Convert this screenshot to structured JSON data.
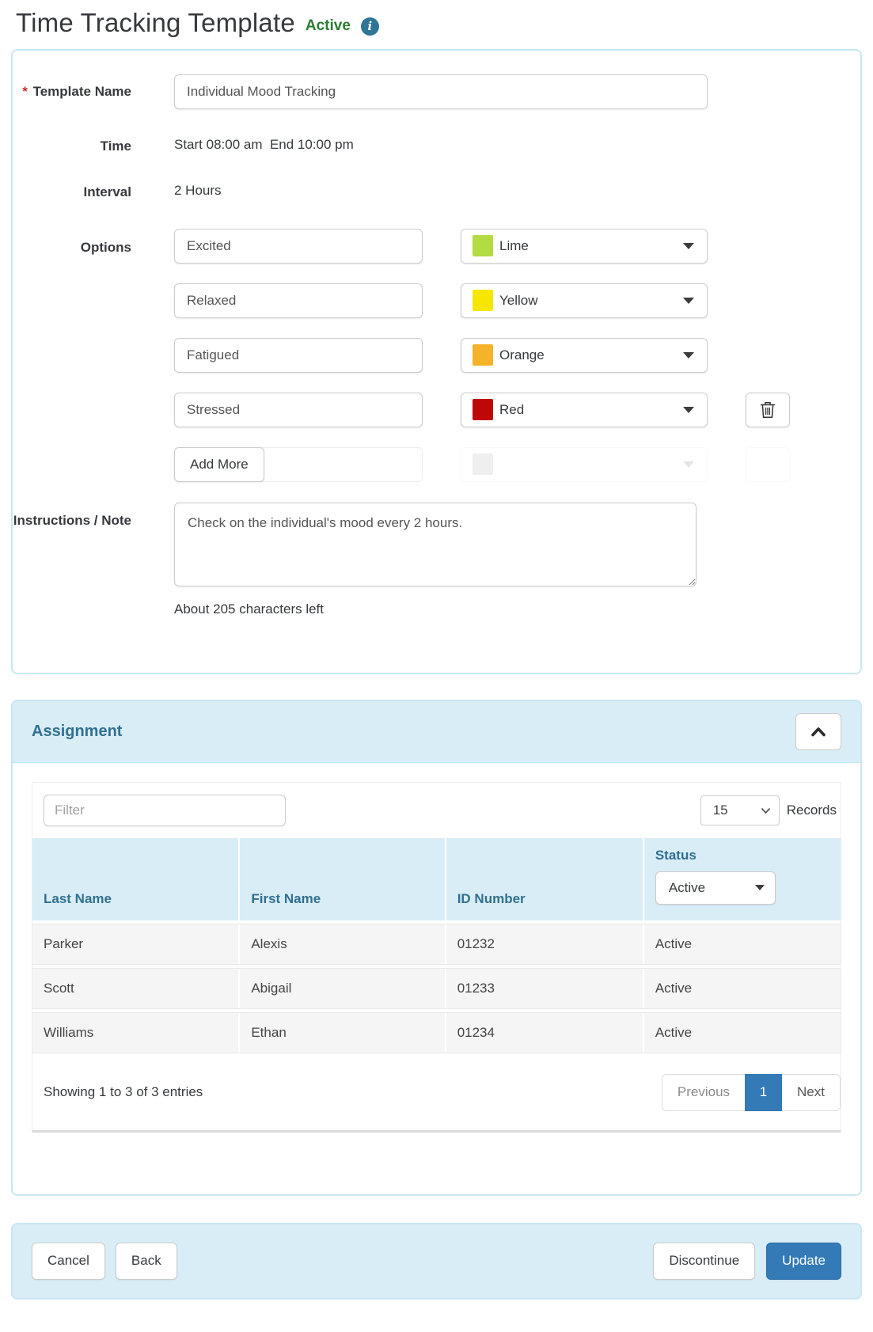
{
  "page": {
    "title": "Time Tracking Template",
    "status_badge": "Active"
  },
  "icons": {
    "info": "info-circle",
    "collapse": "chevron-up",
    "delete": "trash",
    "color_dropdown": "caret-down",
    "records_select": "chevron-down"
  },
  "colors": {
    "accent_blue": "#337ab7",
    "panel_border": "#c9e7f2",
    "section_header_bg": "#d9edf7",
    "section_header_text": "#31708f",
    "active_green": "#2e7d32",
    "info_icon_bg": "#2e7596",
    "required_red": "#c9302c"
  },
  "form": {
    "template_name": {
      "required_mark": "*",
      "label": "Template Name",
      "value": "Individual Mood Tracking"
    },
    "time": {
      "label": "Time",
      "value": "Start 08:00 am  End 10:00 pm"
    },
    "interval": {
      "label": "Interval",
      "value": "2 Hours"
    },
    "options": {
      "label": "Options",
      "rows": [
        {
          "name": "Excited",
          "color_label": "Lime",
          "color": "#b2dc41"
        },
        {
          "name": "Relaxed",
          "color_label": "Yellow",
          "color": "#f7e700"
        },
        {
          "name": "Fatigued",
          "color_label": "Orange",
          "color": "#f5b32a"
        },
        {
          "name": "Stressed",
          "color_label": "Red",
          "color": "#c00707"
        }
      ],
      "add_more_label": "Add More"
    },
    "instructions": {
      "label": "Instructions / Note",
      "value": "Check on the individual's mood every 2 hours.",
      "hint": "About 205 characters left"
    }
  },
  "assignment": {
    "title": "Assignment",
    "filter_placeholder": "Filter",
    "records_per_page": "15",
    "records_label": "Records",
    "table": {
      "columns": [
        "Last Name",
        "First Name",
        "ID Number",
        "Status"
      ],
      "status_filter": "Active",
      "rows": [
        {
          "last": "Parker",
          "first": "Alexis",
          "id": "01232",
          "status": "Active"
        },
        {
          "last": "Scott",
          "first": "Abigail",
          "id": "01233",
          "status": "Active"
        },
        {
          "last": "Williams",
          "first": "Ethan",
          "id": "01234",
          "status": "Active"
        }
      ]
    },
    "summary": "Showing 1 to 3 of 3 entries",
    "pagination": {
      "previous": "Previous",
      "page": "1",
      "next": "Next"
    }
  },
  "footer": {
    "cancel": "Cancel",
    "back": "Back",
    "discontinue": "Discontinue",
    "update": "Update"
  }
}
